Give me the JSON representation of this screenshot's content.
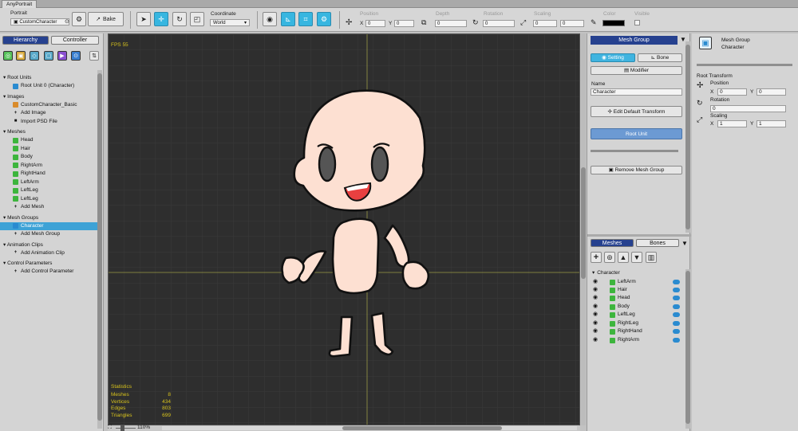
{
  "app_tab": "AnyPortrait",
  "toolbar": {
    "portrait_label": "Portrait",
    "portrait_value": "CustomCharacter",
    "bake_label": "Bake",
    "coordinate_label": "Coordinate",
    "coordinate_value": "World",
    "position_label": "Position",
    "pos_x_label": "X",
    "pos_x": "0",
    "pos_y_label": "Y",
    "pos_y": "0",
    "depth_label": "Depth",
    "depth": "0",
    "rotation_label": "Rotation",
    "rotation": "0",
    "scaling_label": "Scaling",
    "scale_x": "0",
    "scale_y": "0",
    "color_label": "Color",
    "visible_label": "Visible",
    "accent": "#37b6e0"
  },
  "left": {
    "tab_hierarchy": "Hierarchy",
    "tab_controller": "Controller",
    "sort_icon": "⇅",
    "root_units_header": "Root Units",
    "root_unit": "Root Unit 0 (Character)",
    "images_header": "Images",
    "image_item": "CustomCharacter_Basic",
    "add_image": "Add Image",
    "import_psd": "Import PSD File",
    "meshes_header": "Meshes",
    "meshes": [
      "Head",
      "Hair",
      "Body",
      "RightArm",
      "RightHand",
      "LeftArm",
      "LeftLeg",
      "LeftLeg"
    ],
    "add_mesh": "Add Mesh",
    "mesh_groups_header": "Mesh Groups",
    "mesh_group_item": "Character",
    "add_mesh_group": "Add Mesh Group",
    "anim_header": "Animation Clips",
    "add_anim": "Add Animation Clip",
    "params_header": "Control Parameters",
    "add_param": "Add Control Parameter"
  },
  "viewport": {
    "fps": "FPS 55",
    "stats_title": "Statistics",
    "stats": [
      {
        "label": "Meshes",
        "value": "8"
      },
      {
        "label": "Vertices",
        "value": "434"
      },
      {
        "label": "Edges",
        "value": "803"
      },
      {
        "label": "Triangles",
        "value": "699"
      }
    ],
    "zoom": "110%"
  },
  "right": {
    "header": "Mesh Group",
    "tab_setting": "Setting",
    "tab_bone": "Bone",
    "modifier": "Modifier",
    "name_label": "Name",
    "name_value": "Character",
    "edit_transform": "Edit Default Transform",
    "root_unit": "Root Unit",
    "remove_group": "Remove Mesh Group",
    "tab_meshes": "Meshes",
    "tab_bones": "Bones",
    "list_header": "Character",
    "list_items": [
      "LeftArm",
      "Hair",
      "Head",
      "Body",
      "LeftLeg",
      "RightLeg",
      "RightHand",
      "RightArm"
    ]
  },
  "inspector": {
    "title1": "Mesh Group",
    "title2": "Character",
    "root_transform": "Root Transform",
    "position_label": "Position",
    "pos_x_label": "X",
    "pos_x": "0",
    "pos_y_label": "Y",
    "pos_y": "0",
    "rotation_label": "Rotation",
    "rotation": "0",
    "scaling_label": "Scaling",
    "scale_x_label": "X",
    "scale_x": "1",
    "scale_y_label": "Y",
    "scale_y": "1"
  }
}
